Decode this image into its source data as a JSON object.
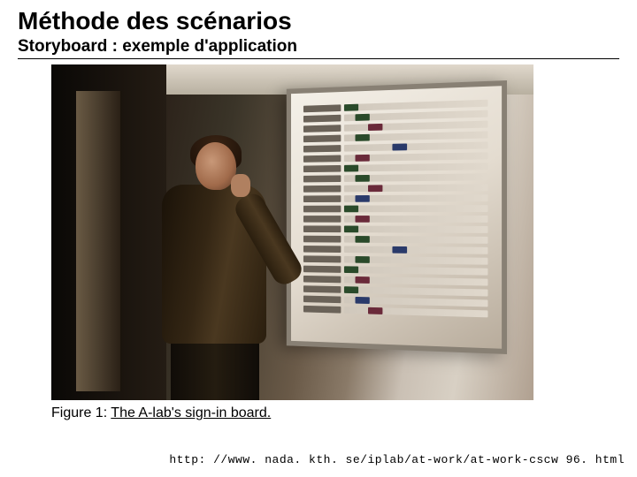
{
  "title": "Méthode des scénarios",
  "subtitle": "Storyboard : exemple d'application",
  "figure": {
    "label": "Figure 1: ",
    "caption": "The A-lab's sign-in board.",
    "alt": "Photograph of a person standing in a hallway looking at a wall-mounted sign-in whiteboard with many horizontal name rows and colored markers."
  },
  "source_url": "http: //www. nada. kth. se/iplab/at-work/at-work-cscw 96. html"
}
